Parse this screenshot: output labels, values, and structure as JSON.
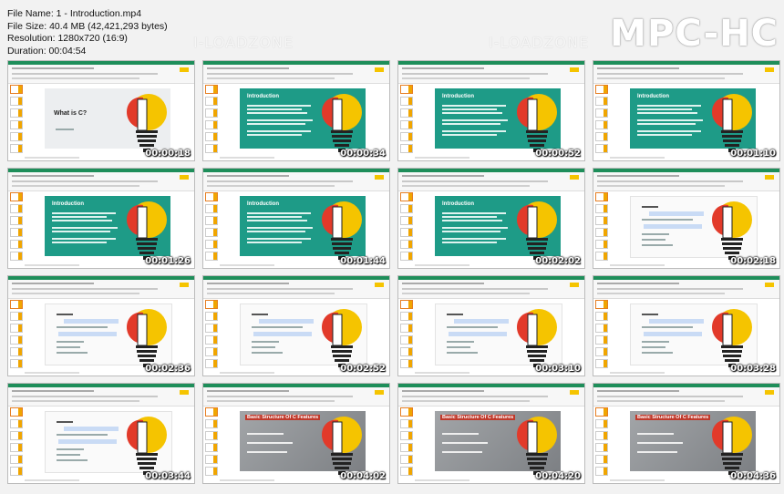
{
  "info": {
    "file_name": "File Name: 1 - Introduction.mp4",
    "file_size": "File Size: 40.4 MB (42,421,293 bytes)",
    "resolution": "Resolution: 1280x720 (16:9)",
    "duration": "Duration: 00:04:54"
  },
  "logo": "MPC-HC",
  "watermark": "I-LOADZONE",
  "thumbnails": [
    {
      "time": "00:00:18",
      "slide": "title",
      "slide_title": "What is C?"
    },
    {
      "time": "00:00:34",
      "slide": "teal",
      "slide_title": "Introduction"
    },
    {
      "time": "00:00:52",
      "slide": "teal",
      "slide_title": "Introduction"
    },
    {
      "time": "00:01:10",
      "slide": "teal",
      "slide_title": "Introduction"
    },
    {
      "time": "00:01:26",
      "slide": "teal",
      "slide_title": "Introduction"
    },
    {
      "time": "00:01:44",
      "slide": "teal",
      "slide_title": "Introduction"
    },
    {
      "time": "00:02:02",
      "slide": "teal",
      "slide_title": "Introduction"
    },
    {
      "time": "00:02:18",
      "slide": "code",
      "slide_title": ""
    },
    {
      "time": "00:02:36",
      "slide": "code",
      "slide_title": ""
    },
    {
      "time": "00:02:52",
      "slide": "code",
      "slide_title": ""
    },
    {
      "time": "00:03:10",
      "slide": "code",
      "slide_title": ""
    },
    {
      "time": "00:03:28",
      "slide": "code",
      "slide_title": ""
    },
    {
      "time": "00:03:44",
      "slide": "code",
      "slide_title": ""
    },
    {
      "time": "00:04:02",
      "slide": "photo",
      "slide_title": "Basic Structure Of C Features"
    },
    {
      "time": "00:04:20",
      "slide": "photo",
      "slide_title": "Basic Structure Of C Features"
    },
    {
      "time": "00:04:36",
      "slide": "photo",
      "slide_title": "Basic Structure Of C Features"
    }
  ],
  "colors": {
    "teal": "#1e9b87",
    "bulb_yellow": "#f5c400",
    "bulb_red": "#e23a2a",
    "accent_green": "#1e8e5a"
  }
}
